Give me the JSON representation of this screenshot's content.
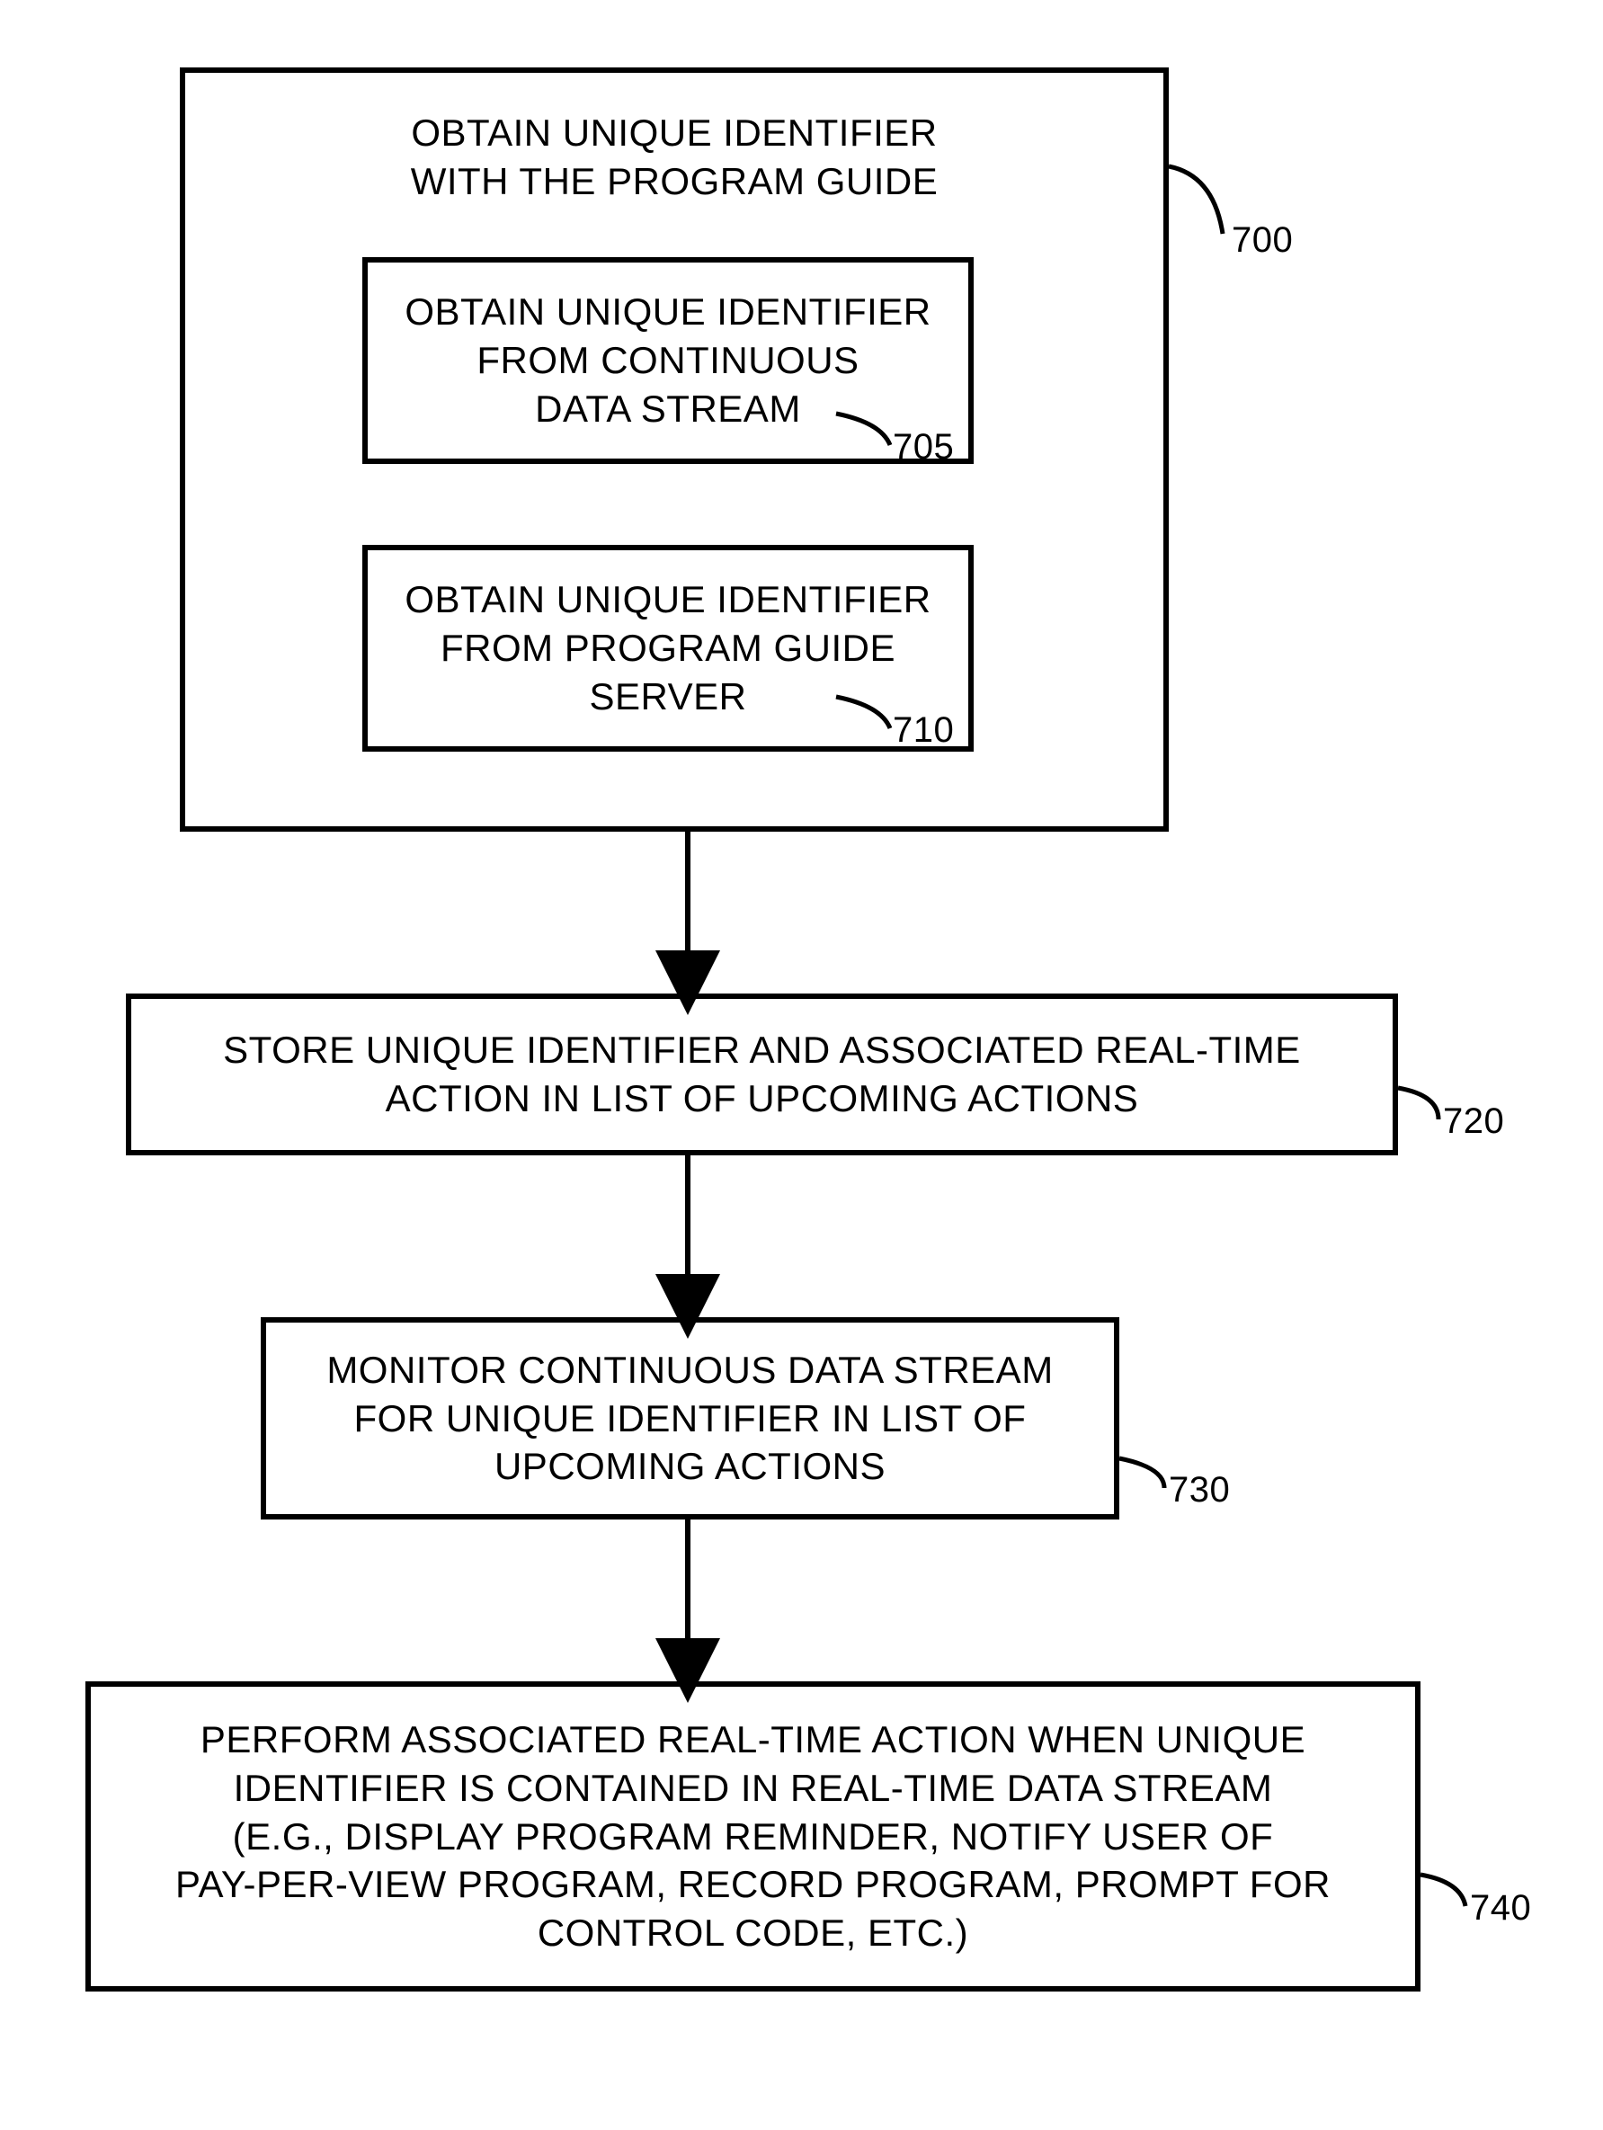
{
  "chart_data": {
    "type": "flowchart",
    "nodes": [
      {
        "id": "700",
        "label": "OBTAIN UNIQUE IDENTIFIER WITH THE PROGRAM GUIDE",
        "children": [
          {
            "id": "705",
            "label": "OBTAIN UNIQUE IDENTIFIER FROM CONTINUOUS DATA STREAM"
          },
          {
            "id": "710",
            "label": "OBTAIN UNIQUE IDENTIFIER FROM PROGRAM GUIDE SERVER"
          }
        ]
      },
      {
        "id": "720",
        "label": "STORE UNIQUE IDENTIFIER AND ASSOCIATED REAL-TIME ACTION IN LIST OF UPCOMING ACTIONS"
      },
      {
        "id": "730",
        "label": "MONITOR CONTINUOUS DATA STREAM FOR UNIQUE IDENTIFIER IN LIST OF UPCOMING ACTIONS"
      },
      {
        "id": "740",
        "label": "PERFORM ASSOCIATED REAL-TIME ACTION WHEN UNIQUE IDENTIFIER IS CONTAINED IN REAL-TIME DATA STREAM (E.G.,  DISPLAY PROGRAM REMINDER, NOTIFY USER OF PAY-PER-VIEW PROGRAM, RECORD PROGRAM, PROMPT FOR CONTROL CODE, ETC.)"
      }
    ],
    "edges": [
      {
        "from": "700",
        "to": "720"
      },
      {
        "from": "720",
        "to": "730"
      },
      {
        "from": "730",
        "to": "740"
      }
    ]
  },
  "box700_title": "OBTAIN UNIQUE IDENTIFIER\nWITH THE PROGRAM GUIDE",
  "box705": "OBTAIN UNIQUE IDENTIFIER\nFROM CONTINUOUS\nDATA STREAM",
  "box710": "OBTAIN UNIQUE IDENTIFIER\nFROM PROGRAM GUIDE\nSERVER",
  "box720": "STORE UNIQUE IDENTIFIER AND ASSOCIATED REAL-TIME\nACTION IN LIST OF UPCOMING ACTIONS",
  "box730": "MONITOR CONTINUOUS DATA STREAM\nFOR UNIQUE IDENTIFIER IN LIST OF\nUPCOMING ACTIONS",
  "box740": "PERFORM ASSOCIATED REAL-TIME ACTION WHEN UNIQUE\nIDENTIFIER IS CONTAINED IN REAL-TIME DATA STREAM\n(E.G.,  DISPLAY PROGRAM REMINDER, NOTIFY USER OF\nPAY-PER-VIEW PROGRAM, RECORD PROGRAM, PROMPT FOR\nCONTROL CODE, ETC.)",
  "label700": "700",
  "label705": "705",
  "label710": "710",
  "label720": "720",
  "label730": "730",
  "label740": "740"
}
